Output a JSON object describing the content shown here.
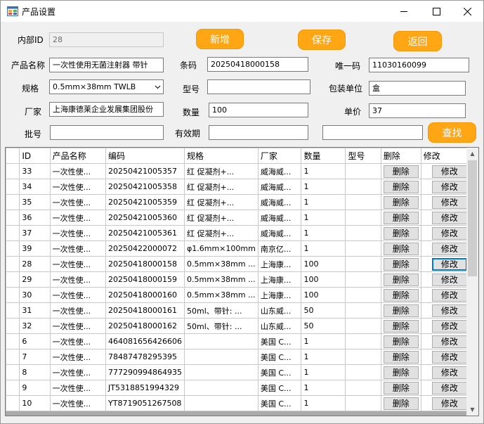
{
  "window": {
    "title": "产品设置",
    "icon": "app-window-icon",
    "minimize_icon": "minimize-icon",
    "maximize_icon": "maximize-icon",
    "close_icon": "close-icon"
  },
  "form": {
    "internal_id": {
      "label": "内部ID",
      "value": "28"
    },
    "product_name": {
      "label": "产品名称",
      "value": "一次性使用无菌注射器 带针"
    },
    "barcode": {
      "label": "条码",
      "value": "20250418000158"
    },
    "unique_code": {
      "label": "唯一码",
      "value": "11030160099"
    },
    "spec": {
      "label": "规格",
      "value": "0.5mm×38mm TWLB"
    },
    "model": {
      "label": "型号",
      "value": ""
    },
    "package_unit": {
      "label": "包装单位",
      "value": "盒"
    },
    "manufacturer": {
      "label": "厂家",
      "value": "上海康德莱企业发展集团股份"
    },
    "quantity": {
      "label": "数量",
      "value": "100"
    },
    "unit_price": {
      "label": "单价",
      "value": "37"
    },
    "batch": {
      "label": "批号",
      "value": ""
    },
    "expiry": {
      "label": "有效期",
      "value": ""
    },
    "search": {
      "value": ""
    }
  },
  "buttons": {
    "add": "新增",
    "save": "保存",
    "back": "返回",
    "search": "查找"
  },
  "table": {
    "columns": [
      "ID",
      "产品名称",
      "编码",
      "规格",
      "厂家",
      "数量",
      "型号",
      "删除",
      "修改"
    ],
    "delete_label": "删除",
    "edit_label": "修改",
    "rows": [
      {
        "id": "33",
        "name": "一次性使...",
        "code": "20250421005357",
        "spec": "红 促凝剂+...",
        "maker": "威海威...",
        "qty": "1",
        "model": ""
      },
      {
        "id": "34",
        "name": "一次性使...",
        "code": "20250421005358",
        "spec": "红 促凝剂+...",
        "maker": "威海威...",
        "qty": "1",
        "model": ""
      },
      {
        "id": "35",
        "name": "一次性使...",
        "code": "20250421005359",
        "spec": "红 促凝剂+...",
        "maker": "威海威...",
        "qty": "1",
        "model": ""
      },
      {
        "id": "36",
        "name": "一次性使...",
        "code": "20250421005360",
        "spec": "红 促凝剂+...",
        "maker": "威海威...",
        "qty": "1",
        "model": ""
      },
      {
        "id": "37",
        "name": "一次性使...",
        "code": "20250421005361",
        "spec": "红 促凝剂+...",
        "maker": "威海威...",
        "qty": "1",
        "model": ""
      },
      {
        "id": "39",
        "name": "一次性使...",
        "code": "20250422000072",
        "spec": "φ1.6mm×100mm",
        "maker": "南京亿...",
        "qty": "1",
        "model": ""
      },
      {
        "id": "28",
        "name": "一次性使...",
        "code": "20250418000158",
        "spec": "0.5mm×38mm ...",
        "maker": "上海康...",
        "qty": "100",
        "model": ""
      },
      {
        "id": "29",
        "name": "一次性使...",
        "code": "20250418000159",
        "spec": "0.5mm×38mm ...",
        "maker": "上海康...",
        "qty": "100",
        "model": ""
      },
      {
        "id": "30",
        "name": "一次性使...",
        "code": "20250418000160",
        "spec": "0.5mm×38mm ...",
        "maker": "上海康...",
        "qty": "100",
        "model": ""
      },
      {
        "id": "31",
        "name": "一次性使...",
        "code": "20250418000161",
        "spec": "50ml、带针: ...",
        "maker": "山东威...",
        "qty": "50",
        "model": ""
      },
      {
        "id": "32",
        "name": "一次性使...",
        "code": "20250418000162",
        "spec": "50ml、带针: ...",
        "maker": "山东威...",
        "qty": "50",
        "model": ""
      },
      {
        "id": "6",
        "name": "一次性使...",
        "code": "464081656426606",
        "spec": "",
        "maker": "美国 C...",
        "qty": "1",
        "model": ""
      },
      {
        "id": "7",
        "name": "一次性使...",
        "code": "78487478295395",
        "spec": "",
        "maker": "美国 C...",
        "qty": "1",
        "model": ""
      },
      {
        "id": "8",
        "name": "一次性使...",
        "code": "777290994864935",
        "spec": "",
        "maker": "美国 C...",
        "qty": "1",
        "model": ""
      },
      {
        "id": "9",
        "name": "一次性使...",
        "code": "JT5318851994329",
        "spec": "",
        "maker": "美国 C...",
        "qty": "1",
        "model": ""
      },
      {
        "id": "10",
        "name": "一次性使...",
        "code": "YT8719051267508",
        "spec": "",
        "maker": "美国 C...",
        "qty": "1",
        "model": ""
      }
    ]
  },
  "colors": {
    "accent_button": "#ffa615",
    "focus": "#0078d7"
  }
}
